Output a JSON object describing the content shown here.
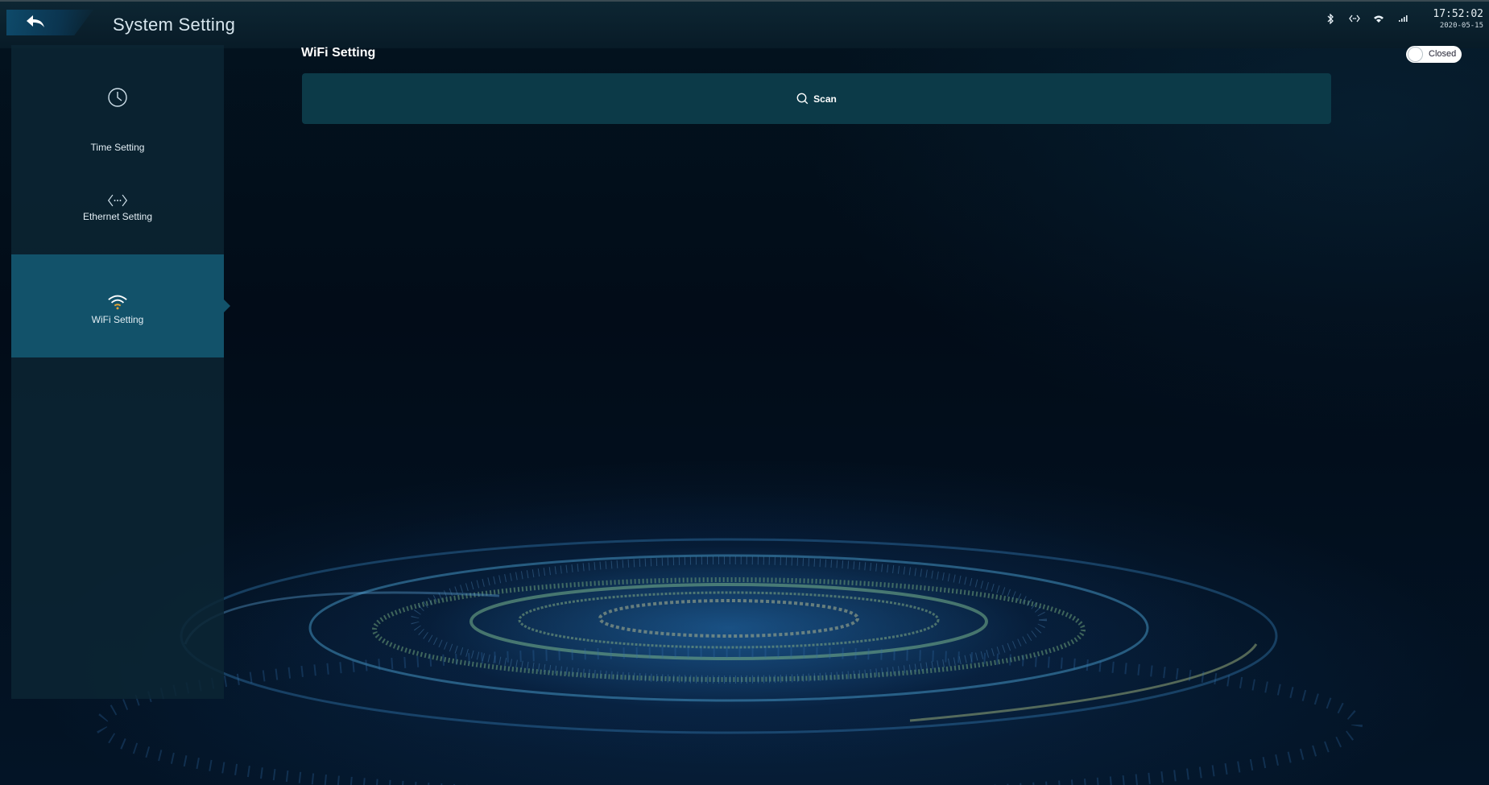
{
  "app": {
    "title": "System Setting"
  },
  "status": {
    "time": "17:52:02",
    "date": "2020-05-15",
    "icons": [
      "bluetooth-icon",
      "ethernet-icon",
      "wifi-icon",
      "signal-icon"
    ]
  },
  "sidebar": {
    "items": [
      {
        "label": "Time Setting",
        "icon": "clock-icon",
        "active": false
      },
      {
        "label": "Ethernet Setting",
        "icon": "ethernet-icon",
        "active": false
      },
      {
        "label": "WiFi Setting",
        "icon": "wifi-icon",
        "active": true
      }
    ]
  },
  "main": {
    "section_title": "WiFi Setting",
    "toggle_label": "Closed",
    "scan_label": "Scan"
  },
  "colors": {
    "accent": "#12526a",
    "wifi_icon_accent": "#e3a435"
  }
}
